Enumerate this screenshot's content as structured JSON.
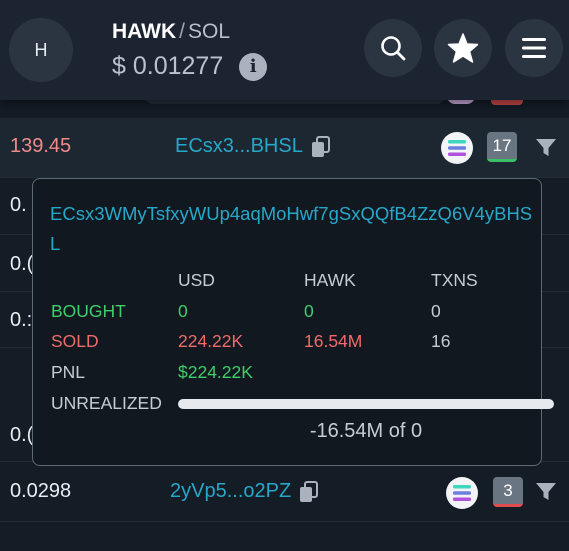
{
  "header": {
    "avatar_initial": "H",
    "base_symbol": "HAWK",
    "separator": "/",
    "quote_symbol": "SOL",
    "price": "$ 0.01277",
    "info_icon": "info-icon",
    "buttons": [
      "search-icon",
      "star-icon",
      "menu-icon"
    ]
  },
  "rows": [
    {
      "amount": "139.45",
      "amount_color": "#f08a8a",
      "address": "ECsx3...BHSL",
      "count": "17",
      "count_bar_color": "#39c163"
    },
    {
      "amount": "0.",
      "amount_color": "#e8edf2"
    },
    {
      "amount": "0.(",
      "amount_color": "#e8edf2"
    },
    {
      "amount": "0.:",
      "amount_color": "#e8edf2"
    },
    {
      "amount": "0.(",
      "amount_color": "#e8edf2"
    },
    {
      "amount": "0.0298",
      "amount_color": "#e8edf2",
      "address": "2yVp5...o2PZ",
      "count": "3",
      "count_bar_color": "#e04b4b"
    }
  ],
  "tooltip": {
    "address": "ECsx3WMyTsfxyWUp4aqMoHwf7gSxQQfB4ZzQ6V4yBHSL",
    "columns": [
      "USD",
      "HAWK",
      "TXNS"
    ],
    "bought": {
      "label": "BOUGHT",
      "usd": "0",
      "token": "0",
      "txns": "0"
    },
    "sold": {
      "label": "SOLD",
      "usd": "224.22K",
      "token": "16.54M",
      "txns": "16"
    },
    "pnl": {
      "label": "PNL",
      "usd": "$224.22K"
    },
    "unrealized": {
      "label": "UNREALIZED",
      "progress": 1.0,
      "value": "-16.54M of 0"
    }
  },
  "colors": {
    "accent": "#27a8c9",
    "positive": "#3fcf6a",
    "negative": "#f06a6a"
  }
}
